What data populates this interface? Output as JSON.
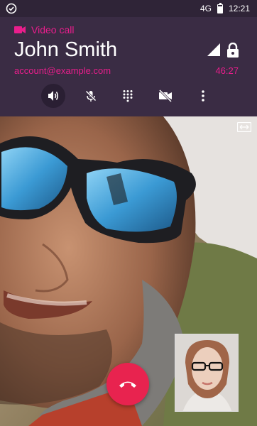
{
  "status_bar": {
    "network": "4G",
    "time": "12:21"
  },
  "call": {
    "type_label": "Video call",
    "contact_name": "John Smith",
    "account": "account@example.com",
    "duration": "46:27"
  },
  "controls": [
    {
      "name": "speaker",
      "icon": "speaker-icon",
      "active": true
    },
    {
      "name": "mute",
      "icon": "mic-off-icon",
      "active": false
    },
    {
      "name": "dialpad",
      "icon": "dialpad-icon",
      "active": false
    },
    {
      "name": "video-off",
      "icon": "videocam-off-icon",
      "active": false
    },
    {
      "name": "more",
      "icon": "more-vert-icon",
      "active": false
    }
  ],
  "colors": {
    "accent": "#e91e8c",
    "header_bg": "#3a2c44",
    "end_call": "#e8234f"
  }
}
